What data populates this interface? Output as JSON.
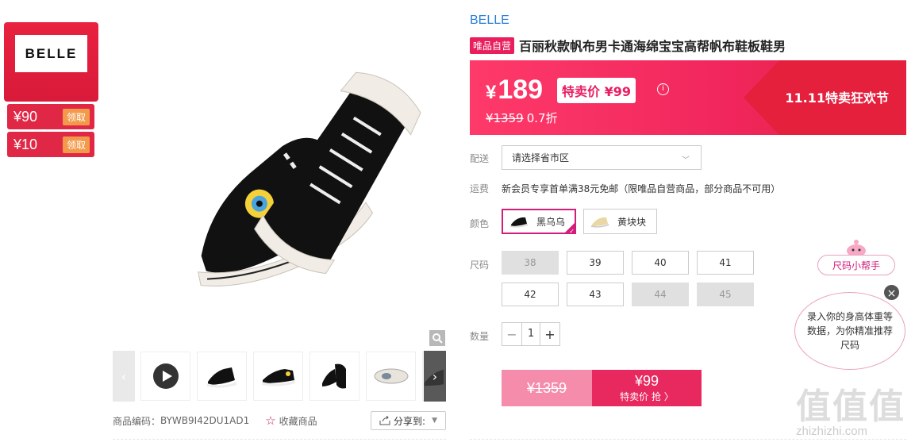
{
  "brand_card": {
    "logo": "BELLE",
    "coupons": [
      {
        "amount": "¥90",
        "action": "领取"
      },
      {
        "amount": "¥10",
        "action": "领取"
      }
    ]
  },
  "gallery": {
    "thumbnails": [
      "play-video-icon",
      "shoe-side-icon",
      "shoe-profile-icon",
      "shoe-pair-icon",
      "shoe-sole-icon",
      "shoe-partial-icon"
    ]
  },
  "meta": {
    "sku_label": "商品编码：",
    "sku_value": "BYWB9I42DU1AD1",
    "favorite": "收藏商品",
    "share": "分享到:"
  },
  "product": {
    "brand": "BELLE",
    "tag": "唯品自营",
    "title": "百丽秋款帆布男卡通海绵宝宝高帮帆布鞋板鞋男"
  },
  "price": {
    "current": "189",
    "yen": "¥",
    "special_label": "特卖价 ¥99",
    "original": "¥1359",
    "discount": "0.7折",
    "festival": "11.11特卖狂欢节"
  },
  "delivery": {
    "label": "配送",
    "placeholder": "请选择省市区"
  },
  "freight": {
    "label": "运费",
    "text": "新会员专享首单满38元免邮（限唯品自营商品，部分商品不可用）"
  },
  "colors": {
    "label": "颜色",
    "options": [
      {
        "name": "黑乌乌",
        "selected": true
      },
      {
        "name": "黄块块",
        "selected": false
      }
    ]
  },
  "sizes": {
    "label": "尺码",
    "options": [
      {
        "size": "38",
        "available": false
      },
      {
        "size": "39",
        "available": true
      },
      {
        "size": "40",
        "available": true
      },
      {
        "size": "41",
        "available": true
      },
      {
        "size": "42",
        "available": true
      },
      {
        "size": "43",
        "available": true
      },
      {
        "size": "44",
        "available": false
      },
      {
        "size": "45",
        "available": false
      }
    ]
  },
  "quantity": {
    "label": "数量",
    "value": "1",
    "minus": "−",
    "plus": "+"
  },
  "buy": {
    "original": "¥1359",
    "price": "¥99",
    "action": "特卖价 抢 〉"
  },
  "helper": {
    "label": "尺码小帮手",
    "text": "录入你的身高体重等数据，为你精准推荐尺码",
    "close": "×"
  },
  "watermark": {
    "text": "值值值",
    "url": "zhizhizhi.com"
  },
  "colors_theme": {
    "accent": "#e8295f",
    "brand_red": "#e02846",
    "link_blue": "#2a7fd6"
  }
}
